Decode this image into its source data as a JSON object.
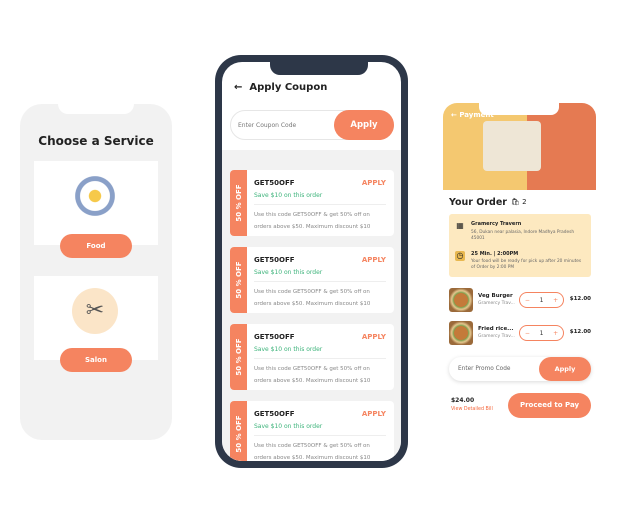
{
  "service_screen": {
    "title": "Choose a Service",
    "services": [
      {
        "label": "Food",
        "icon": "food-plate-icon"
      },
      {
        "label": "Salon",
        "icon": "scissors-comb-icon"
      }
    ]
  },
  "coupon_screen": {
    "title": "Apply Coupon",
    "input_placeholder": "Enter Coupon Code",
    "apply_label": "Apply",
    "coupons": [
      {
        "tag": "50 % OFF",
        "code": "GET50OFF",
        "action": "APPLY",
        "save": "Save $10 on this order",
        "desc": "Use this code GET50OFF & get 50% off on orders above $50. Maximum discount $10"
      },
      {
        "tag": "50 % OFF",
        "code": "GET50OFF",
        "action": "APPLY",
        "save": "Save $10 on this order",
        "desc": "Use this code GET50OFF & get 50% off on orders above $50. Maximum discount $10"
      },
      {
        "tag": "50 % OFF",
        "code": "GET50OFF",
        "action": "APPLY",
        "save": "Save $10 on this order",
        "desc": "Use this code GET50OFF & get 50% off on orders above $50. Maximum discount $10"
      },
      {
        "tag": "50 % OFF",
        "code": "GET50OFF",
        "action": "APPLY",
        "save": "Save $10 on this order",
        "desc": "Use this code GET50OFF & get 50% off on orders above $50. Maximum discount $10"
      }
    ]
  },
  "payment_screen": {
    "title": "Payment",
    "order_title": "Your Order",
    "item_count": "2",
    "restaurant": {
      "name": "Gramercy Travern",
      "address": "56, Dukan near palasia, Indore Madhya Pradesh 45001"
    },
    "pickup": {
      "time": "25 Min. | 2:00PM",
      "note": "Your food will be ready for pick up after 20 minutes of Order by 2:00 PM"
    },
    "items": [
      {
        "name": "Veg Burger",
        "restaurant": "Gramercy Trav...",
        "qty": "1",
        "price": "$12.00"
      },
      {
        "name": "Fried rice...",
        "restaurant": "Gramercy Trav...",
        "qty": "1",
        "price": "$12.00"
      }
    ],
    "promo_placeholder": "Enter Promo Code",
    "promo_apply": "Apply",
    "total": "$24.00",
    "view_bill": "View Detailed Bill",
    "pay_label": "Proceed to Pay"
  },
  "colors": {
    "accent": "#f58460",
    "frame": "#2d3748",
    "success": "#3cb37a",
    "info_box": "#fde9c0"
  }
}
